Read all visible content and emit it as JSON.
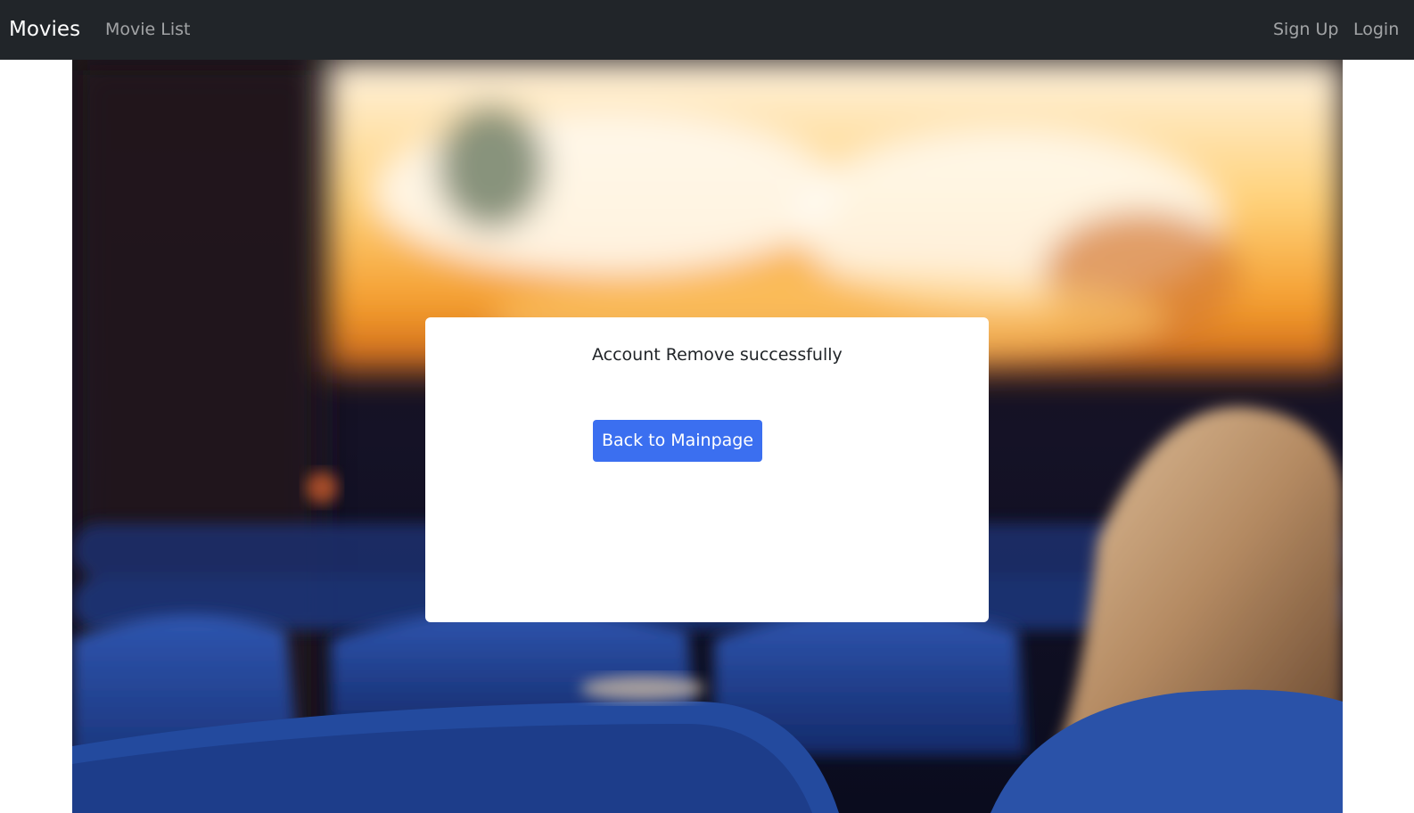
{
  "navbar": {
    "brand": "Movies",
    "links": [
      {
        "label": "Movie List"
      },
      {
        "label": "Sign Up"
      },
      {
        "label": "Login"
      }
    ]
  },
  "main": {
    "message": "Account Remove successfully",
    "back_button_label": "Back to Mainpage"
  },
  "colors": {
    "navbar_bg": "#212529",
    "button_bg": "#3b6ff0",
    "card_bg": "#ffffff"
  }
}
